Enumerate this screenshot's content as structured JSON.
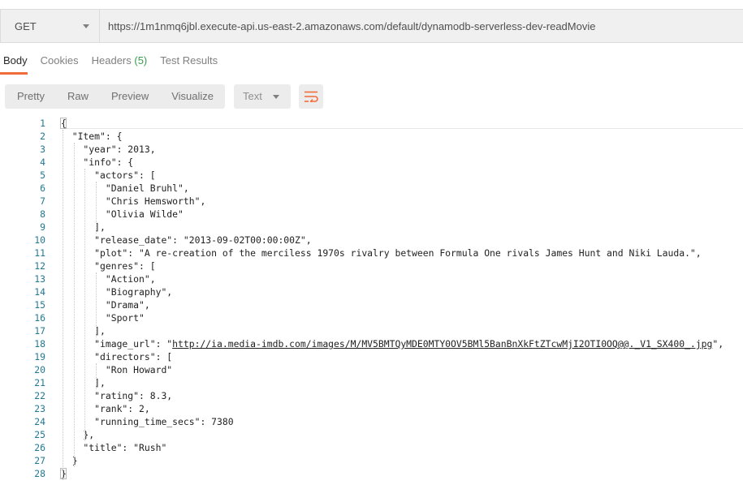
{
  "request": {
    "method": "GET",
    "url": "https://1m1nmq6jbl.execute-api.us-east-2.amazonaws.com/default/dynamodb-serverless-dev-readMovie"
  },
  "response_tabs": [
    {
      "label": "Body",
      "count": ""
    },
    {
      "label": "Cookies",
      "count": ""
    },
    {
      "label": "Headers",
      "count": "(5)"
    },
    {
      "label": "Test Results",
      "count": ""
    }
  ],
  "view_modes": [
    "Pretty",
    "Raw",
    "Preview",
    "Visualize"
  ],
  "format": "Text",
  "icons": {
    "method_caret": "chevron-down-icon",
    "format_caret": "chevron-down-icon",
    "wrap": "wrap-lines-icon"
  },
  "colors": {
    "accent": "#f26b3a",
    "headers_count": "#3a9c4b",
    "line_numbers": "#237893"
  },
  "code_lines": [
    {
      "n": "1",
      "text": "{"
    },
    {
      "n": "2",
      "text": "  \"Item\": {"
    },
    {
      "n": "3",
      "text": "    \"year\": 2013,"
    },
    {
      "n": "4",
      "text": "    \"info\": {"
    },
    {
      "n": "5",
      "text": "      \"actors\": ["
    },
    {
      "n": "6",
      "text": "        \"Daniel Bruhl\","
    },
    {
      "n": "7",
      "text": "        \"Chris Hemsworth\","
    },
    {
      "n": "8",
      "text": "        \"Olivia Wilde\""
    },
    {
      "n": "9",
      "text": "      ],"
    },
    {
      "n": "10",
      "text": "      \"release_date\": \"2013-09-02T00:00:00Z\","
    },
    {
      "n": "11",
      "text": "      \"plot\": \"A re-creation of the merciless 1970s rivalry between Formula One rivals James Hunt and Niki Lauda.\","
    },
    {
      "n": "12",
      "text": "      \"genres\": ["
    },
    {
      "n": "13",
      "text": "        \"Action\","
    },
    {
      "n": "14",
      "text": "        \"Biography\","
    },
    {
      "n": "15",
      "text": "        \"Drama\","
    },
    {
      "n": "16",
      "text": "        \"Sport\""
    },
    {
      "n": "17",
      "text": "      ],"
    },
    {
      "n": "18",
      "text": "      \"image_url\": \"",
      "link": "http://ia.media-imdb.com/images/M/MV5BMTQyMDE0MTY0OV5BMl5BanBnXkFtZTcwMjI2OTI0OQ@@._V1_SX400_.jpg",
      "after": "\","
    },
    {
      "n": "19",
      "text": "      \"directors\": ["
    },
    {
      "n": "20",
      "text": "        \"Ron Howard\""
    },
    {
      "n": "21",
      "text": "      ],"
    },
    {
      "n": "22",
      "text": "      \"rating\": 8.3,"
    },
    {
      "n": "23",
      "text": "      \"rank\": 2,"
    },
    {
      "n": "24",
      "text": "      \"running_time_secs\": 7380"
    },
    {
      "n": "25",
      "text": "    },"
    },
    {
      "n": "26",
      "text": "    \"title\": \"Rush\""
    },
    {
      "n": "27",
      "text": "  }"
    },
    {
      "n": "28",
      "text": "}"
    }
  ]
}
